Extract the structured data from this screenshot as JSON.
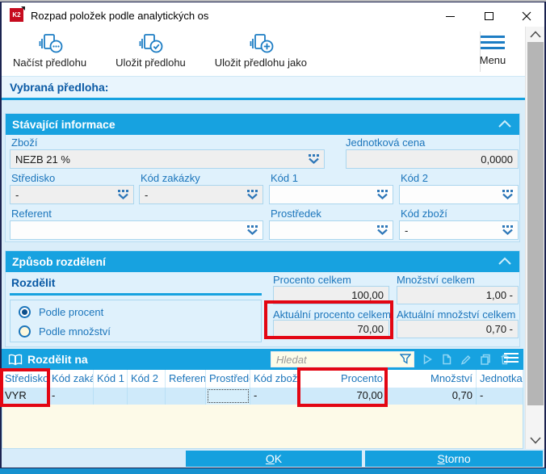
{
  "window": {
    "title": "Rozpad položek podle analytických os",
    "icon_text": "K2"
  },
  "toolbar": {
    "buttons": [
      {
        "label": "Načíst předlohu",
        "icon": "template-load-icon"
      },
      {
        "label": "Uložit předlohu",
        "icon": "template-save-icon"
      },
      {
        "label": "Uložit předlohu jako",
        "icon": "template-save-as-icon"
      }
    ],
    "menu_label": "Menu"
  },
  "selected_template": {
    "label": "Vybraná předloha:"
  },
  "current_info": {
    "title": "Stávající informace",
    "fields": {
      "zbozi": {
        "label": "Zboží",
        "value": "NEZB 21 %"
      },
      "jednotkova_cena": {
        "label": "Jednotková cena",
        "value": "0,0000"
      },
      "stredisko": {
        "label": "Středisko",
        "value": "-"
      },
      "kod_zakazky": {
        "label": "Kód zakázky",
        "value": "-"
      },
      "kod1": {
        "label": "Kód 1",
        "value": ""
      },
      "kod2": {
        "label": "Kód 2",
        "value": ""
      },
      "referent": {
        "label": "Referent",
        "value": ""
      },
      "prostredek": {
        "label": "Prostředek",
        "value": ""
      },
      "kod_zbozi": {
        "label": "Kód zboží",
        "value": "-"
      }
    }
  },
  "distribution": {
    "title": "Způsob rozdělení",
    "rozdelit_label": "Rozdělit",
    "radios": [
      {
        "label": "Podle procent",
        "selected": true
      },
      {
        "label": "Podle množství",
        "selected": false
      }
    ],
    "totals": {
      "procento_celkem": {
        "label": "Procento celkem",
        "value": "100,00"
      },
      "mnozstvi_celkem": {
        "label": "Množství celkem",
        "value": "1,00 -"
      },
      "aktualni_procento": {
        "label": "Aktuální procento celkem",
        "value": "70,00"
      },
      "aktualni_mnozstvi": {
        "label": "Aktuální množství celkem",
        "value": "0,70 -"
      }
    }
  },
  "split_table": {
    "title": "Rozdělit na",
    "search_placeholder": "Hledat",
    "columns": [
      "Středisko",
      "Kód zakázky",
      "Kód 1",
      "Kód 2",
      "Referent",
      "Prostředek",
      "Kód zboží",
      "Procento",
      "Množství",
      "Jednotka"
    ],
    "rows": [
      [
        "VYR",
        "-",
        "",
        "",
        "",
        "",
        "-",
        "70,00",
        "0,70",
        "-"
      ]
    ]
  },
  "footer": {
    "ok_underlined": "O",
    "ok_rest": "K",
    "storno_underlined": "S",
    "storno_rest": "torno"
  },
  "colors": {
    "header_blue": "#17a2e0",
    "panel_bg": "#dff1fc",
    "label_blue": "#1b75bb",
    "annotation_red": "#e30613",
    "row_blue": "#cfeafa",
    "empty_area_yellow": "#fdfae8",
    "window_border_navy": "#1b2350",
    "k2_logo_red": "#c60b1e"
  }
}
